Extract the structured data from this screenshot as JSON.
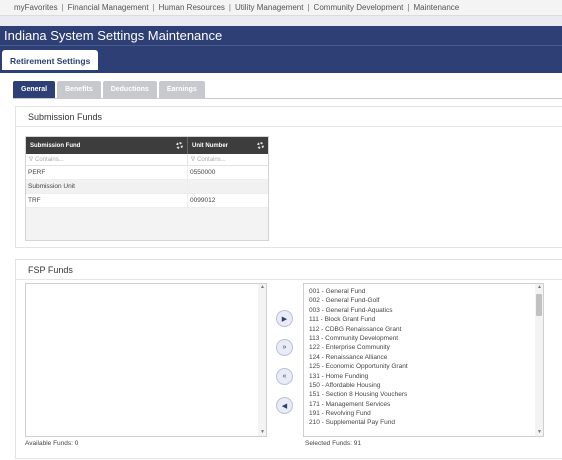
{
  "top_nav": [
    "myFavorites",
    "Financial Management",
    "Human Resources",
    "Utility Management",
    "Community Development",
    "Maintenance"
  ],
  "page_title": "Indiana System Settings Maintenance",
  "main_tab": "Retirement Settings",
  "sub_tabs": [
    "General",
    "Benefits",
    "Deductions",
    "Earnings"
  ],
  "submission_funds": {
    "heading": "Submission Funds",
    "columns": [
      "Submission Fund",
      "Unit Number"
    ],
    "filter_placeholder": "Contains...",
    "rows": [
      {
        "fund": "PERF",
        "unit": "0550000"
      },
      {
        "fund": "Submission Unit",
        "unit": ""
      },
      {
        "fund": "TRF",
        "unit": "0099012"
      }
    ]
  },
  "fsp_funds": {
    "heading": "FSP Funds",
    "available_label": "Available Funds: 0",
    "selected_label": "Selected Funds: 91",
    "selected": [
      "001 - General Fund",
      "002 - General Fund-Golf",
      "003 - General Fund-Aquatics",
      "111 - Block Grant Fund",
      "112 - CDBG Renaissance Grant",
      "113 - Community Development",
      "122 - Enterprise Community",
      "124 - Renaissance Alliance",
      "125 - Economic Opportunity Grant",
      "131 - Home Funding",
      "150 - Affordable Housing",
      "151 - Section 8 Housing Vouchers",
      "171 - Management Services",
      "191 - Revolving Fund",
      "210 - Supplemental Pay Fund"
    ]
  },
  "icons": {
    "move_right": "▶",
    "move_all_right": "»",
    "move_all_left": "«",
    "move_left": "◀",
    "filter": "∇",
    "scroll_up": "▲",
    "scroll_down": "▼"
  },
  "colors": {
    "header": "#2e3f75",
    "grid_header": "#3d3d3d",
    "inactive_tab": "#c8c8cf"
  }
}
